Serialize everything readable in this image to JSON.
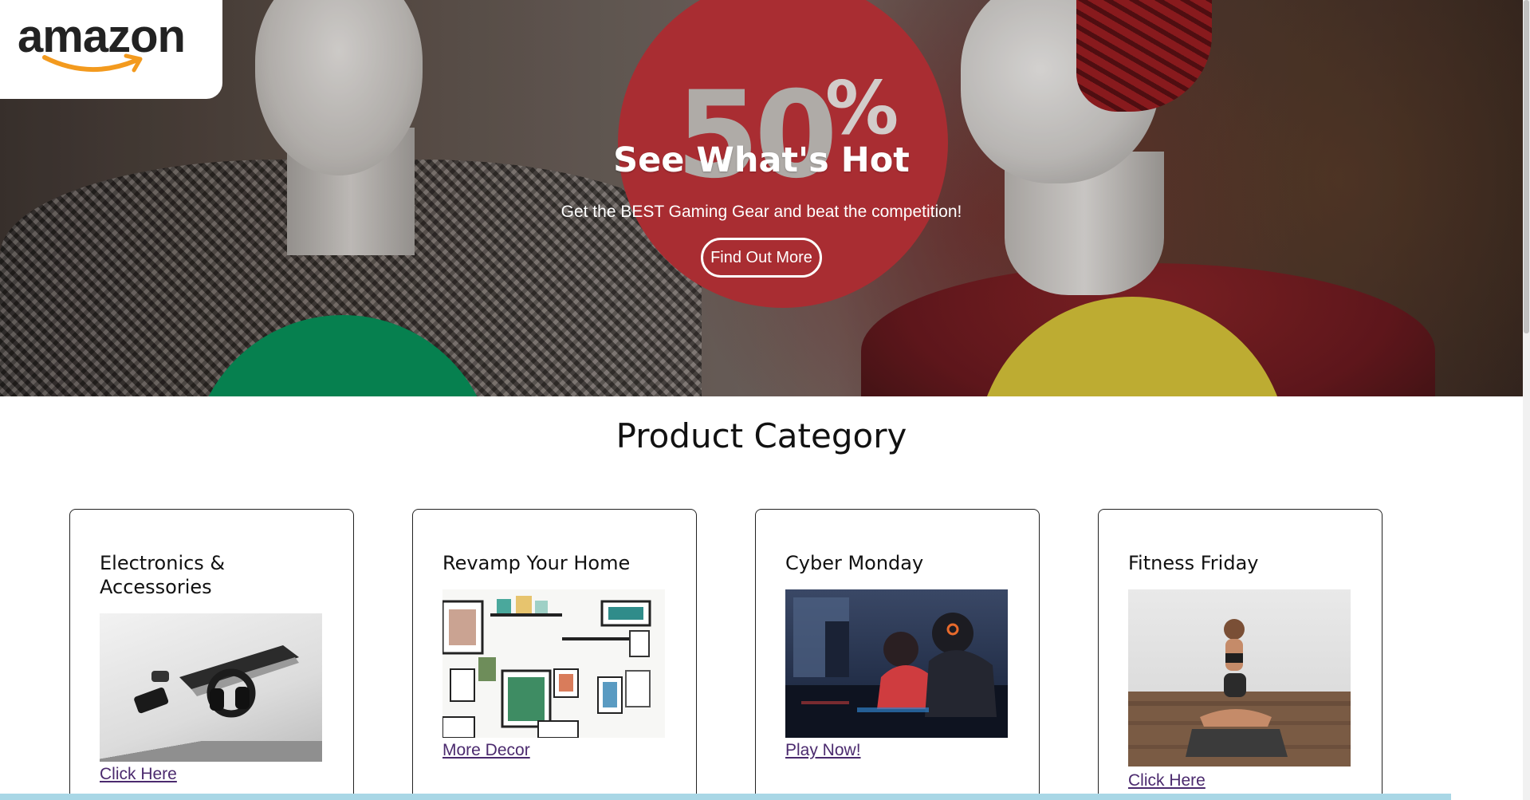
{
  "logo": {
    "text": "amazon"
  },
  "hero": {
    "badge_number": "50",
    "badge_percent": "%",
    "title": "See What's Hot",
    "subtitle": "Get the BEST Gaming Gear and beat the competition!",
    "button_label": "Find Out More"
  },
  "section": {
    "title": "Product Category"
  },
  "cards": [
    {
      "title": "Electronics & Accessories",
      "link": "Click Here"
    },
    {
      "title": "Revamp Your Home",
      "link": "More Decor"
    },
    {
      "title": "Cyber Monday",
      "link": "Play Now!"
    },
    {
      "title": "Fitness Friday",
      "link": "Click Here"
    }
  ],
  "colors": {
    "hero_red": "#c1343a",
    "hero_green": "#07925a",
    "hero_yellow": "#d8c43a",
    "link": "#4b2a6e",
    "logo_smile": "#f39a1e",
    "bottom_bar": "#a9d7e6"
  }
}
